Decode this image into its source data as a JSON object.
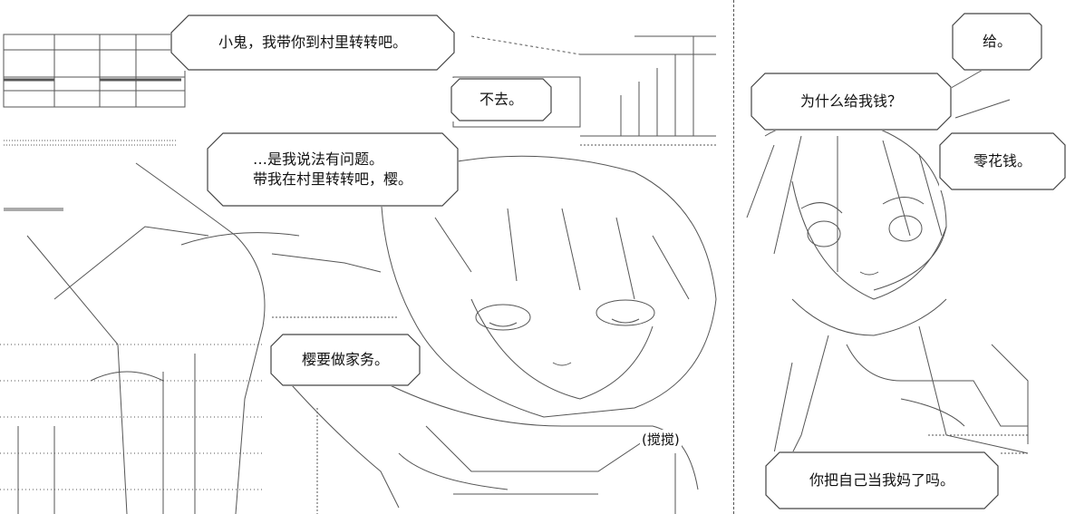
{
  "left_panel": {
    "bubbles": [
      {
        "id": "xiaogui",
        "text": "小鬼，我带你到村里转转吧。"
      },
      {
        "id": "buqu",
        "text": "不去。"
      },
      {
        "id": "wenti_line1",
        "text": "…是我说法有问题。"
      },
      {
        "id": "wenti_line2",
        "text": "带我在村里转转吧，樱。"
      },
      {
        "id": "jiawu",
        "text": "樱要做家务。"
      }
    ],
    "sound_effect": "(搅搅)"
  },
  "right_panel": {
    "bubbles": [
      {
        "id": "gei",
        "text": "给。"
      },
      {
        "id": "weishenme",
        "text": "为什么给我钱？"
      },
      {
        "id": "linghuaqian",
        "text": "零花钱。"
      },
      {
        "id": "mama",
        "text": "你把自己当我妈了吗。"
      }
    ]
  },
  "art": {
    "style": "Shift_JIS ASCII art, black line glyphs on white",
    "line_color": "#555555"
  }
}
